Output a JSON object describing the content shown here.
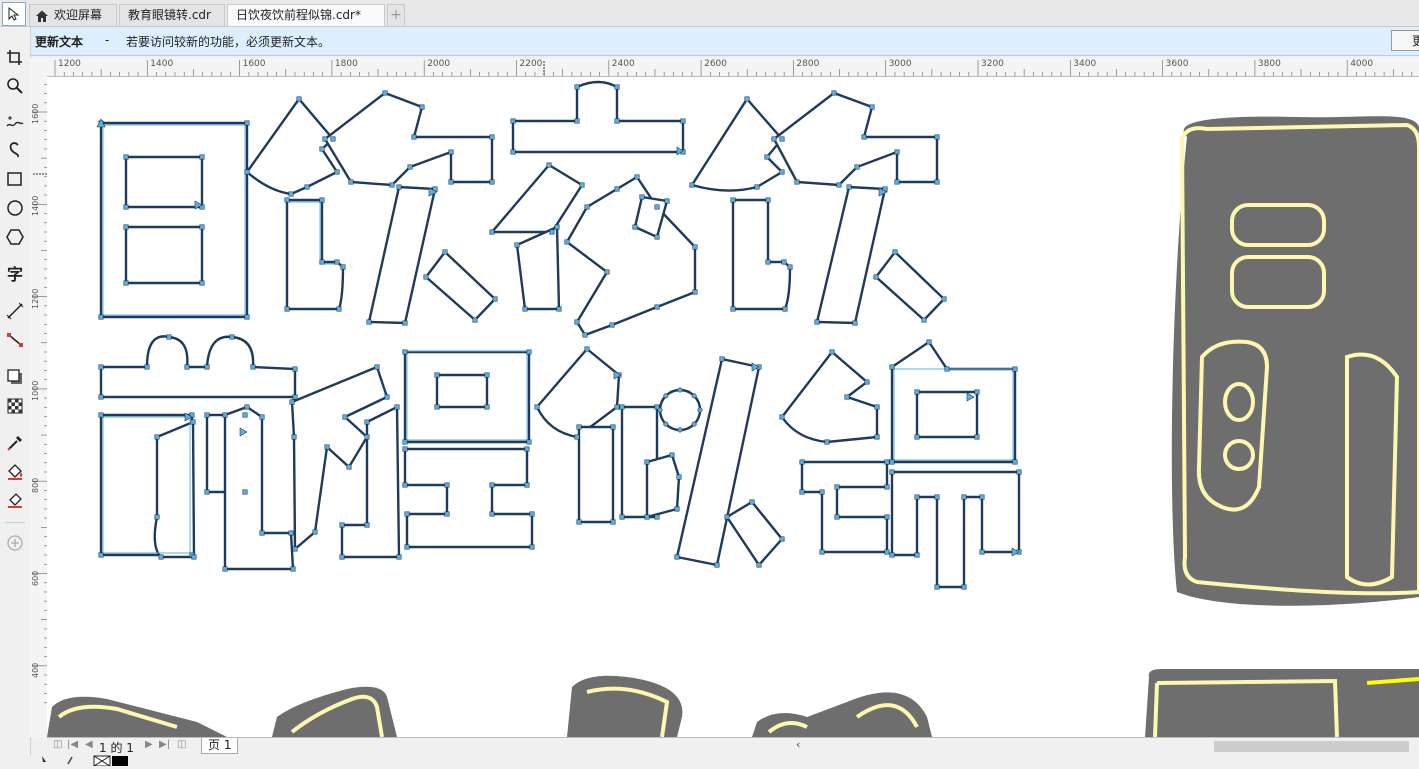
{
  "tabs": [
    {
      "label": "欢迎屏幕",
      "icon": "home-icon"
    },
    {
      "label": "教育眼镜转.cdr"
    },
    {
      "label": "日饮夜饮前程似锦.cdr*"
    }
  ],
  "new_tab_symbol": "+",
  "notification": {
    "title": "更新文本",
    "separator": "-",
    "message": "若要访问较新的功能，必须更新文本。",
    "button_label": "更"
  },
  "rulers": {
    "horizontal_labels": [
      "1200",
      "1400",
      "1600",
      "1800",
      "2000",
      "2200",
      "2400",
      "2600",
      "2800",
      "3000",
      "3200",
      "3400",
      "3600",
      "3800",
      "4000"
    ],
    "vertical_labels": [
      "1600",
      "1400",
      "1200",
      "1000",
      "800",
      "600",
      "400"
    ]
  },
  "toolbox": [
    "pick-tool-icon",
    "crop-tool-icon",
    "zoom-tool-icon",
    "freehand-tool-icon",
    "artistic-media-icon",
    "rectangle-tool-icon",
    "ellipse-tool-icon",
    "polygon-tool-icon",
    "text-tool-icon",
    "parallel-dimension-icon",
    "connector-tool-icon",
    "drop-shadow-icon",
    "transparency-icon",
    "eyedropper-icon",
    "interactive-fill-icon",
    "smart-fill-icon",
    "add-tool-icon"
  ],
  "text_tool_glyph": "字",
  "canvas": {
    "outline_line1": "日饮夜饮",
    "outline_line2": "前程似锦",
    "preview_line1": "日饮",
    "preview_line2": "前程"
  },
  "page_navigation": {
    "counter": "1 的 1",
    "page_tab": "页 1"
  },
  "colors": {
    "outline_stroke": "#1f3a5a",
    "node_color": "#5ab0e0",
    "sticker_gray": "#6e6e6e",
    "sticker_yellow": "#fff7b0",
    "notification_bg": "#ddeeff",
    "bright_yellow": "#ffff00"
  }
}
